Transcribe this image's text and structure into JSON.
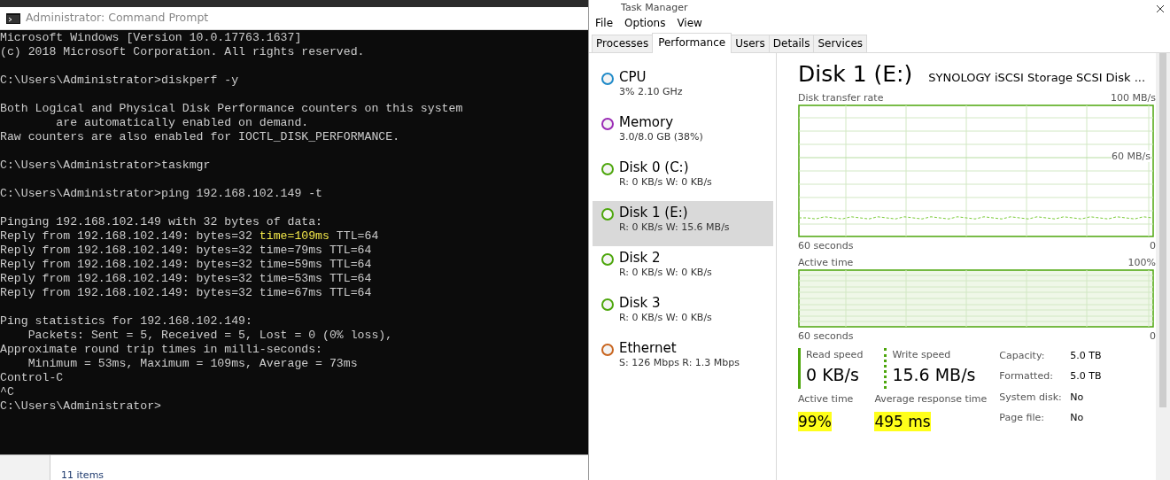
{
  "background_window": {
    "status_text": "11 items"
  },
  "command_prompt": {
    "title": "Administrator: Command Prompt",
    "blocks": [
      {
        "lines": [
          {
            "text": "Microsoft Windows [Version 10.0.17763.1637]"
          },
          {
            "text": "(c) 2018 Microsoft Corporation. All rights reserved."
          }
        ]
      },
      {
        "lines": [
          {
            "text": "C:\\Users\\Administrator>diskperf -y"
          }
        ]
      },
      {
        "lines": [
          {
            "text": "Both Logical and Physical Disk Performance counters on this system"
          },
          {
            "text": "        are automatically enabled on demand."
          },
          {
            "text": "Raw counters are also enabled for IOCTL_DISK_PERFORMANCE."
          }
        ]
      },
      {
        "lines": [
          {
            "text": "C:\\Users\\Administrator>taskmgr"
          }
        ]
      },
      {
        "lines": [
          {
            "text": "C:\\Users\\Administrator>ping 192.168.102.149 -t"
          }
        ]
      },
      {
        "lines": [
          {
            "text": "Pinging 192.168.102.149 with 32 bytes of data:"
          },
          {
            "segments": [
              {
                "text": "Reply from 192.168.102.149: bytes=32 ",
                "highlighted": false
              },
              {
                "text": "time=109ms",
                "highlighted": true
              },
              {
                "text": " TTL=64",
                "highlighted": false
              }
            ]
          },
          {
            "text": "Reply from 192.168.102.149: bytes=32 time=79ms TTL=64"
          },
          {
            "text": "Reply from 192.168.102.149: bytes=32 time=59ms TTL=64"
          },
          {
            "text": "Reply from 192.168.102.149: bytes=32 time=53ms TTL=64"
          },
          {
            "text": "Reply from 192.168.102.149: bytes=32 time=67ms TTL=64"
          }
        ]
      },
      {
        "lines": [
          {
            "text": "Ping statistics for 192.168.102.149:"
          },
          {
            "text": "    Packets: Sent = 5, Received = 5, Lost = 0 (0% loss),"
          },
          {
            "text": "Approximate round trip times in milli-seconds:"
          },
          {
            "text": "    Minimum = 53ms, Maximum = 109ms, Average = 73ms"
          },
          {
            "text": "Control-C"
          },
          {
            "text": "^C"
          },
          {
            "text": "C:\\Users\\Administrator>"
          }
        ]
      }
    ]
  },
  "task_manager": {
    "title": "Task Manager",
    "menu": [
      "File",
      "Options",
      "View"
    ],
    "tabs": [
      {
        "label": "Processes",
        "selected": false
      },
      {
        "label": "Performance",
        "selected": true
      },
      {
        "label": "Users",
        "selected": false
      },
      {
        "label": "Details",
        "selected": false
      },
      {
        "label": "Services",
        "selected": false
      }
    ],
    "sidebar": {
      "items": [
        {
          "name": "CPU",
          "detail": "3% 2.10 GHz",
          "color": "#1f8ac8",
          "selected": false
        },
        {
          "name": "Memory",
          "detail": "3.0/8.0 GB (38%)",
          "color": "#9a2bb5",
          "selected": false
        },
        {
          "name": "Disk 0 (C:)",
          "detail": "R: 0 KB/s W: 0 KB/s",
          "color": "#4da60c",
          "selected": false
        },
        {
          "name": "Disk 1 (E:)",
          "detail": "R: 0 KB/s W: 15.6 MB/s",
          "color": "#4da60c",
          "selected": true
        },
        {
          "name": "Disk 2",
          "detail": "R: 0 KB/s W: 0 KB/s",
          "color": "#4da60c",
          "selected": false
        },
        {
          "name": "Disk 3",
          "detail": "R: 0 KB/s W: 0 KB/s",
          "color": "#4da60c",
          "selected": false
        },
        {
          "name": "Ethernet",
          "detail": "S: 126 Mbps R: 1.3 Mbps",
          "color": "#c8651f",
          "selected": false
        }
      ]
    },
    "detail": {
      "title": "Disk 1 (E:)",
      "model": "SYNOLOGY iSCSI Storage SCSI Disk ...",
      "transfer_chart": {
        "label": "Disk transfer rate",
        "max_label": "100 MB/s",
        "mid_label": "60 MB/s",
        "time_label": "60 seconds",
        "end_label": "0"
      },
      "active_chart": {
        "label": "Active time",
        "max_label": "100%",
        "time_label": "60 seconds",
        "end_label": "0"
      },
      "speeds": [
        {
          "label": "Read speed",
          "value": "0 KB/s",
          "kind": "solid"
        },
        {
          "label": "Write speed",
          "value": "15.6 MB/s",
          "kind": "dotted"
        }
      ],
      "metrics": [
        {
          "label": "Active time",
          "value": "99%",
          "highlighted": true
        },
        {
          "label": "Average response time",
          "value": "495 ms",
          "highlighted": true
        }
      ],
      "properties": [
        {
          "label": "Capacity:",
          "value": "5.0 TB"
        },
        {
          "label": "Formatted:",
          "value": "5.0 TB"
        },
        {
          "label": "System disk:",
          "value": "No"
        },
        {
          "label": "Page file:",
          "value": "No"
        }
      ]
    }
  }
}
